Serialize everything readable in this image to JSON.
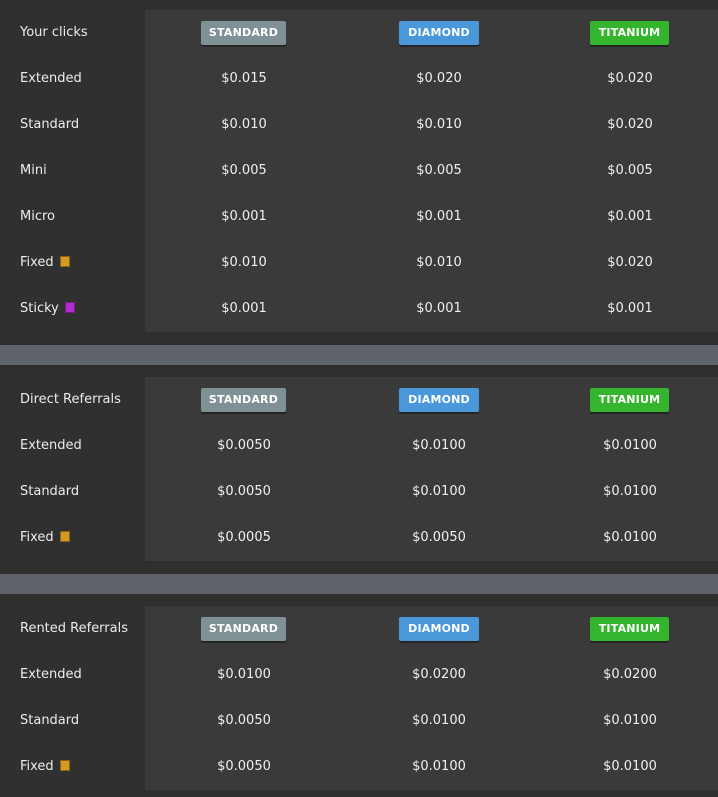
{
  "tiers": {
    "standard": {
      "label": "STANDARD",
      "color": "#7f9194"
    },
    "diamond": {
      "label": "DIAMOND",
      "color": "#4a97d9"
    },
    "titanium": {
      "label": "TITANIUM",
      "color": "#35b52e"
    }
  },
  "swatch_colors": {
    "fixed": "#d39a22",
    "sticky": "#b32dd1"
  },
  "sections": [
    {
      "title": "Your clicks",
      "rows": [
        {
          "label": "Extended",
          "values": [
            "$0.015",
            "$0.020",
            "$0.020"
          ]
        },
        {
          "label": "Standard",
          "values": [
            "$0.010",
            "$0.010",
            "$0.020"
          ]
        },
        {
          "label": "Mini",
          "values": [
            "$0.005",
            "$0.005",
            "$0.005"
          ]
        },
        {
          "label": "Micro",
          "values": [
            "$0.001",
            "$0.001",
            "$0.001"
          ]
        },
        {
          "label": "Fixed",
          "swatch": "fixed",
          "values": [
            "$0.010",
            "$0.010",
            "$0.020"
          ]
        },
        {
          "label": "Sticky",
          "swatch": "sticky",
          "values": [
            "$0.001",
            "$0.001",
            "$0.001"
          ]
        }
      ]
    },
    {
      "title": "Direct Referrals",
      "rows": [
        {
          "label": "Extended",
          "values": [
            "$0.0050",
            "$0.0100",
            "$0.0100"
          ]
        },
        {
          "label": "Standard",
          "values": [
            "$0.0050",
            "$0.0100",
            "$0.0100"
          ]
        },
        {
          "label": "Fixed",
          "swatch": "fixed",
          "values": [
            "$0.0005",
            "$0.0050",
            "$0.0100"
          ]
        }
      ]
    },
    {
      "title": "Rented Referrals",
      "rows": [
        {
          "label": "Extended",
          "values": [
            "$0.0100",
            "$0.0200",
            "$0.0200"
          ]
        },
        {
          "label": "Standard",
          "values": [
            "$0.0050",
            "$0.0100",
            "$0.0100"
          ]
        },
        {
          "label": "Fixed",
          "swatch": "fixed",
          "values": [
            "$0.0050",
            "$0.0100",
            "$0.0100"
          ]
        }
      ]
    }
  ]
}
